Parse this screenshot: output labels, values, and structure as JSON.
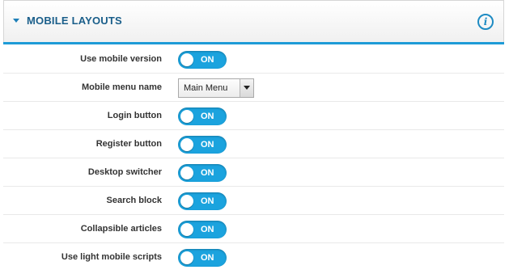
{
  "panel": {
    "title": "MOBILE LAYOUTS",
    "info_glyph": "i",
    "accent_color": "#1e9bd7"
  },
  "settings": [
    {
      "label": "Use mobile version",
      "type": "toggle",
      "state": "ON"
    },
    {
      "label": "Mobile menu name",
      "type": "select",
      "value": "Main Menu"
    },
    {
      "label": "Login button",
      "type": "toggle",
      "state": "ON"
    },
    {
      "label": "Register button",
      "type": "toggle",
      "state": "ON"
    },
    {
      "label": "Desktop switcher",
      "type": "toggle",
      "state": "ON"
    },
    {
      "label": "Search block",
      "type": "toggle",
      "state": "ON"
    },
    {
      "label": "Collapsible articles",
      "type": "toggle",
      "state": "ON"
    },
    {
      "label": "Use light mobile scripts",
      "type": "toggle",
      "state": "ON"
    }
  ]
}
